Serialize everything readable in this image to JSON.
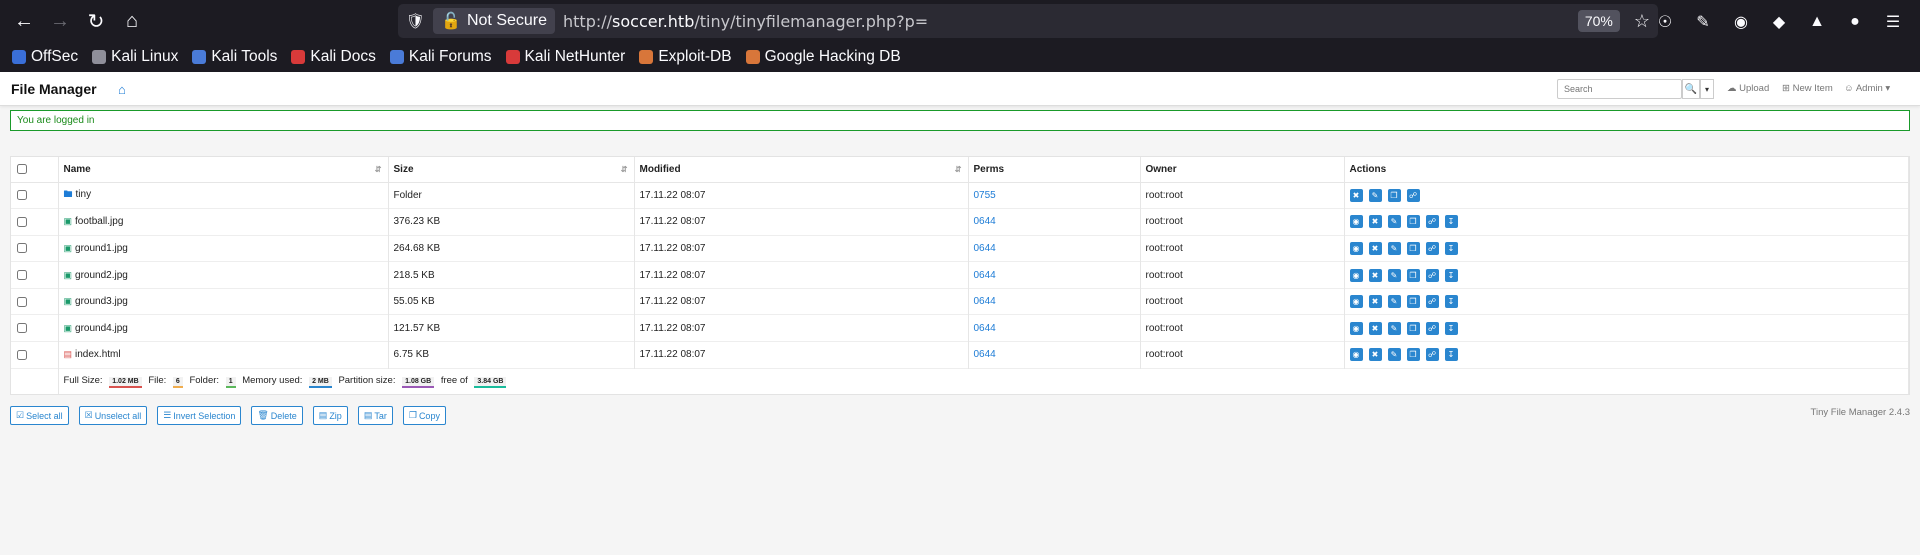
{
  "browser": {
    "not_secure": "Not Secure",
    "url_prefix": "http://",
    "url_host": "soccer.htb",
    "url_path": "/tiny/tinyfilemanager.php?p=",
    "zoom": "70%",
    "bookmarks": [
      {
        "label": "OffSec",
        "color": "#3a6fd8"
      },
      {
        "label": "Kali Linux",
        "color": "#8f8f9a"
      },
      {
        "label": "Kali Tools",
        "color": "#4a7bd8"
      },
      {
        "label": "Kali Docs",
        "color": "#d83a3a"
      },
      {
        "label": "Kali Forums",
        "color": "#4a7bd8"
      },
      {
        "label": "Kali NetHunter",
        "color": "#d83a3a"
      },
      {
        "label": "Exploit-DB",
        "color": "#d8763a"
      },
      {
        "label": "Google Hacking DB",
        "color": "#d8763a"
      }
    ]
  },
  "app": {
    "brand": "File Manager",
    "search_placeholder": "Search",
    "upload": "Upload",
    "new_item": "New Item",
    "admin": "Admin",
    "alert": "You are logged in",
    "columns": {
      "name": "Name",
      "size": "Size",
      "modified": "Modified",
      "perms": "Perms",
      "owner": "Owner",
      "actions": "Actions"
    },
    "files": [
      {
        "name": "tiny",
        "type": "folder",
        "size": "Folder",
        "modified": "17.11.22 08:07",
        "perms": "0755",
        "owner": "root:root"
      },
      {
        "name": "football.jpg",
        "type": "image",
        "size": "376.23 KB",
        "modified": "17.11.22 08:07",
        "perms": "0644",
        "owner": "root:root"
      },
      {
        "name": "ground1.jpg",
        "type": "image",
        "size": "264.68 KB",
        "modified": "17.11.22 08:07",
        "perms": "0644",
        "owner": "root:root"
      },
      {
        "name": "ground2.jpg",
        "type": "image",
        "size": "218.5 KB",
        "modified": "17.11.22 08:07",
        "perms": "0644",
        "owner": "root:root"
      },
      {
        "name": "ground3.jpg",
        "type": "image",
        "size": "55.05 KB",
        "modified": "17.11.22 08:07",
        "perms": "0644",
        "owner": "root:root"
      },
      {
        "name": "ground4.jpg",
        "type": "image",
        "size": "121.57 KB",
        "modified": "17.11.22 08:07",
        "perms": "0644",
        "owner": "root:root"
      },
      {
        "name": "index.html",
        "type": "html",
        "size": "6.75 KB",
        "modified": "17.11.22 08:07",
        "perms": "0644",
        "owner": "root:root"
      }
    ],
    "summary": {
      "full_size_label": "Full Size:",
      "full_size": "1.02 MB",
      "file_label": "File:",
      "file_count": "6",
      "folder_label": "Folder:",
      "folder_count": "1",
      "memory_label": "Memory used:",
      "memory": "2 MB",
      "partition_label": "Partition size:",
      "partition": "1.08 GB",
      "free_label": "free of",
      "free_of": "3.84 GB"
    },
    "buttons": [
      "Select all",
      "Unselect all",
      "Invert Selection",
      "Delete",
      "Zip",
      "Tar",
      "Copy"
    ],
    "version": "Tiny File Manager 2.4.3"
  }
}
